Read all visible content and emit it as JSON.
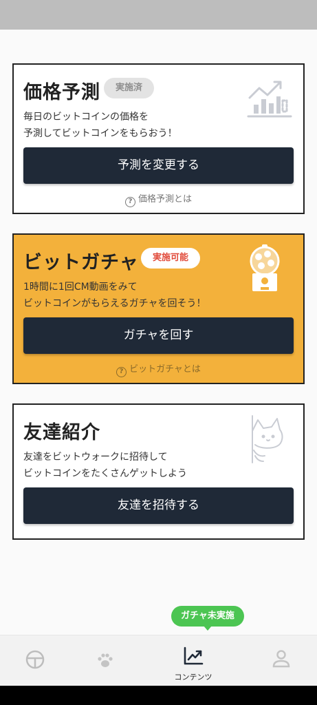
{
  "cards": {
    "predict": {
      "title": "価格予測",
      "badge": "実施済",
      "desc_line1": "毎日のビットコインの価格を",
      "desc_line2": "予測してビットコインをもらおう！",
      "button": "予測を変更する",
      "help": "価格予測とは",
      "icon": "price-chart-icon"
    },
    "gacha": {
      "title": "ビットガチャ",
      "badge": "実施可能",
      "desc_line1": "1時間に1回CM動画をみて",
      "desc_line2": "ビットコインがもらえるガチャを回そう！",
      "button": "ガチャを回す",
      "help": "ビットガチャとは",
      "icon": "gacha-machine-icon"
    },
    "invite": {
      "title": "友達紹介",
      "desc_line1": "友達をビットウォークに招待して",
      "desc_line2": "ビットコインをたくさんゲットしよう",
      "button": "友達を招待する",
      "icon": "peeking-cat-icon"
    }
  },
  "tooltip": "ガチャ未実施",
  "bottom_nav": {
    "items": [
      {
        "icon": "steering-wheel-icon",
        "label": ""
      },
      {
        "icon": "paw-icon",
        "label": ""
      },
      {
        "icon": "trending-chart-icon",
        "label": "コンテンツ",
        "active": true
      },
      {
        "icon": "person-icon",
        "label": ""
      }
    ]
  },
  "colors": {
    "dark_button": "#1f2937",
    "gacha_card": "#f3b13b",
    "badge_available_text": "#e14b3b",
    "tooltip": "#4cc552"
  }
}
